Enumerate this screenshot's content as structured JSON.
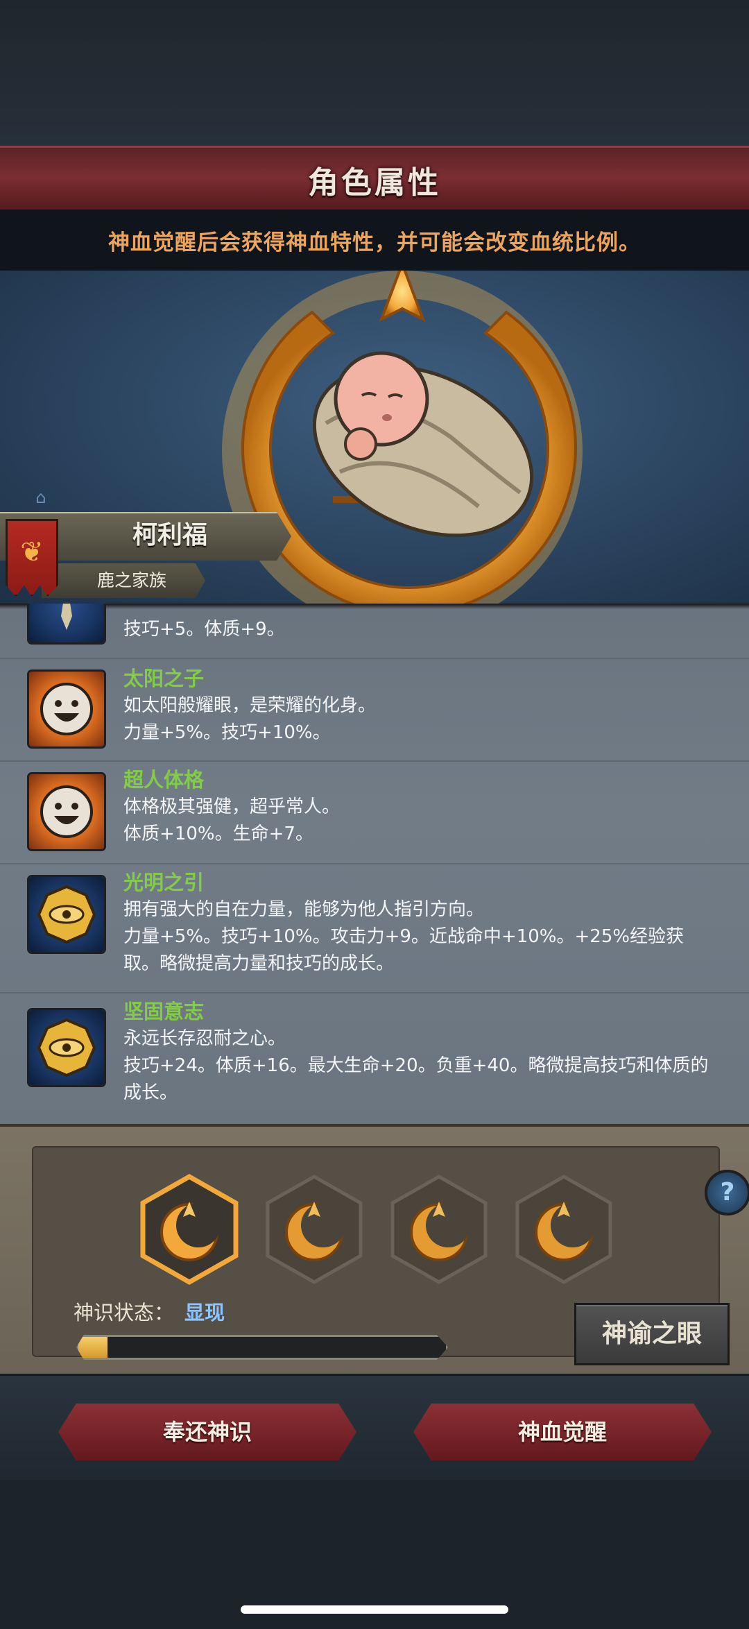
{
  "header": {
    "title": "角色属性",
    "subtitle": "神血觉醒后会获得神血特性，并可能会改变血统比例。"
  },
  "character": {
    "name": "柯利福",
    "family": "鹿之家族"
  },
  "traits": [
    {
      "icon": "feather-icon",
      "name": "",
      "desc": "技巧+5。体质+9。"
    },
    {
      "icon": "sun-face-icon",
      "name": "太阳之子",
      "desc": "如太阳般耀眼，是荣耀的化身。\n力量+5%。技巧+10%。"
    },
    {
      "icon": "sun-face-icon",
      "name": "超人体格",
      "desc": "体格极其强健，超乎常人。\n体质+10%。生命+7。"
    },
    {
      "icon": "golden-eye-medallion-icon",
      "name": "光明之引",
      "desc": "拥有强大的自在力量，能够为他人指引方向。\n力量+5%。技巧+10%。攻击力+9。近战命中+10%。+25%经验获取。略微提高力量和技巧的成长。"
    },
    {
      "icon": "golden-eye-medallion-icon",
      "name": "坚固意志",
      "desc": "永远长存忍耐之心。\n技巧+24。体质+16。最大生命+20。负重+40。略微提高技巧和体质的成长。"
    }
  ],
  "divine_sense": {
    "state_label": "神识状态：",
    "state_value": "显现",
    "progress": 0.08,
    "oracle_button": "神谕之眼",
    "help_icon": "?"
  },
  "actions": {
    "return_label": "奉还神识",
    "awaken_label": "神血觉醒"
  },
  "colors": {
    "accent_gold": "#f2a83a",
    "trait_name_green": "#83cc47",
    "banner_red": "#7a2e33",
    "state_blue": "#8cc4ff"
  }
}
